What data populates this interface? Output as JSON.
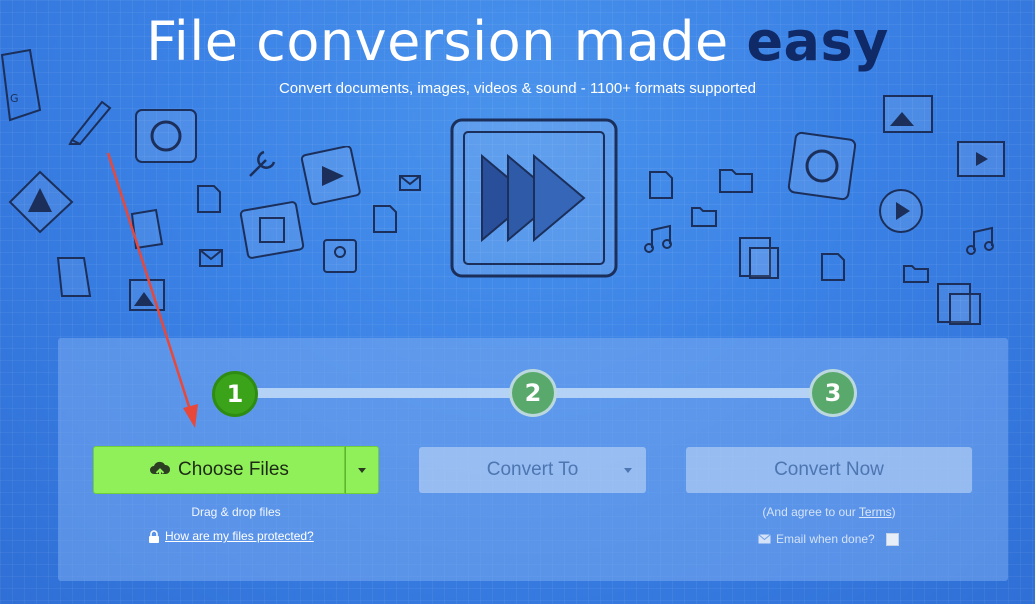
{
  "hero": {
    "title_main": "File conversion made ",
    "title_emphasis": "easy",
    "subtitle": "Convert documents, images, videos & sound - 1100+ formats supported"
  },
  "steps": {
    "step1": "1",
    "step2": "2",
    "step3": "3"
  },
  "actions": {
    "choose_files_label": "Choose Files",
    "convert_to_label": "Convert To",
    "convert_now_label": "Convert Now"
  },
  "helper": {
    "drag_drop": "Drag & drop files",
    "protected_link": "How are my files protected?",
    "agree_prefix": "(And agree to our ",
    "terms_link": "Terms",
    "agree_suffix": ")",
    "email_label": "Email when done?"
  },
  "icons": {
    "upload": "cloud-upload-icon",
    "lock": "lock-icon",
    "envelope": "envelope-icon",
    "hero_play": "fast-forward-icon"
  },
  "colors": {
    "background": "#3b82e6",
    "accent_green": "#8ff05a",
    "step_active": "#3aa31a",
    "title_emphasis": "#0f2a66",
    "annotation_arrow": "#e8483a"
  }
}
